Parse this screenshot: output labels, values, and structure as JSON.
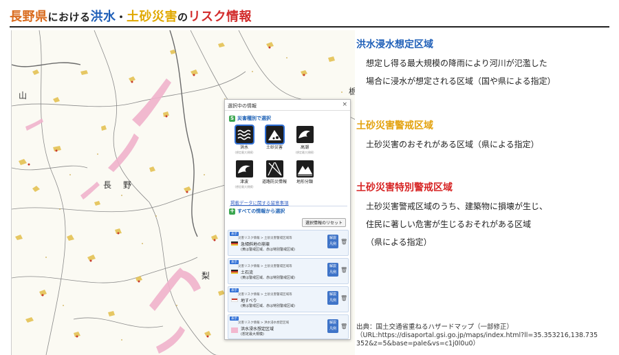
{
  "title": {
    "part1": "長野県",
    "part2": "における",
    "part3": "洪水",
    "part4": "・",
    "part5": "土砂災害",
    "part6": "の",
    "part7": "リスク情報"
  },
  "map": {
    "labels": {
      "nagano_left": "長",
      "nagano_right": "野",
      "kanji_south": "山",
      "kanji_right": "梨",
      "kanji_top": "山",
      "kanji_topright": "栃"
    }
  },
  "panel": {
    "title": "選択中の情報",
    "close": "×",
    "section1": "災害種別で選択",
    "section1_icon": "S",
    "hazards": [
      {
        "label": "洪水",
        "sub": "(想定最大規模)",
        "icon": "flood-icon"
      },
      {
        "label": "土砂災害",
        "sub": "",
        "icon": "landslide-icon"
      },
      {
        "label": "高潮",
        "sub": "(想定最大規模)",
        "icon": "storm-surge-icon"
      },
      {
        "label": "津波",
        "sub": "(想定最大規模)",
        "icon": "tsunami-icon"
      },
      {
        "label": "道路防災情報",
        "sub": "",
        "icon": "road-icon"
      },
      {
        "label": "地形分類",
        "sub": "",
        "icon": "terrain-icon"
      }
    ],
    "note_link": "掲載データに関する留意事項",
    "section2": "すべての情報から選択",
    "section2_icon": "+",
    "reset_button": "選択情報のリセット",
    "cards": [
      {
        "tag": "表示",
        "path": "災害リスク情報 > 土砂災害警戒区域等",
        "name": "急傾斜地の崩壊",
        "note": "(黄は警戒区域、赤は特別警戒区域)",
        "button": "解説 凡例",
        "colors": [
          "#e8c437",
          "#c93a2b"
        ]
      },
      {
        "tag": "表示",
        "path": "災害リスク情報 > 土砂災害警戒区域等",
        "name": "土石流",
        "note": "(黄は警戒区域、赤は特別警戒区域)",
        "button": "解説 凡例",
        "colors": [
          "#e8c437",
          "#c93a2b"
        ]
      },
      {
        "tag": "表示",
        "path": "災害リスク情報 > 土砂災害警戒区域等",
        "name": "地すべり",
        "note": "(黄は警戒区域、赤は特別警戒区域)",
        "button": "解説 凡例",
        "colors": [
          "#e8c437",
          "#c93a2b"
        ]
      },
      {
        "tag": "表示",
        "path": "災害リスク情報 > 洪水浸水想定区域",
        "name": "洪水浸水想定区域",
        "note": "(想定最大規模)",
        "button": "解説 凡例",
        "colors": [
          "#f2b8cf",
          "#f2b8cf"
        ]
      }
    ]
  },
  "right": {
    "h1": "洪水浸水想定区域",
    "b1a": "想定し得る最大規模の降雨により河川が氾濫した",
    "b1b": "場合に浸水が想定される区域（国や県による指定）",
    "h2": "土砂災害警戒区域",
    "b2": "土砂災害のおそれがある区域（県による指定）",
    "h3": "土砂災害特別警戒区域",
    "b3a": "土砂災害警戒区域のうち、建築物に損壊が生じ、",
    "b3b": "住民に著しい危害が生じるおそれがある区域",
    "b3c": "（県による指定）"
  },
  "credit": {
    "line1": "出典：国土交通省重ねるハザードマップ（一部修正）",
    "line2": "（URL:https://disaportal.gsi.go.jp/maps/index.html?ll=35.353216,138.735",
    "line3": "352&z=5&base=pale&vs=c1j0l0u0）"
  },
  "colors": {
    "flood_pink": "#f0b3cc",
    "sediment_yellow": "#e6c44a",
    "sediment_red": "#c93a2b",
    "accent_blue": "#1f5fb8"
  }
}
